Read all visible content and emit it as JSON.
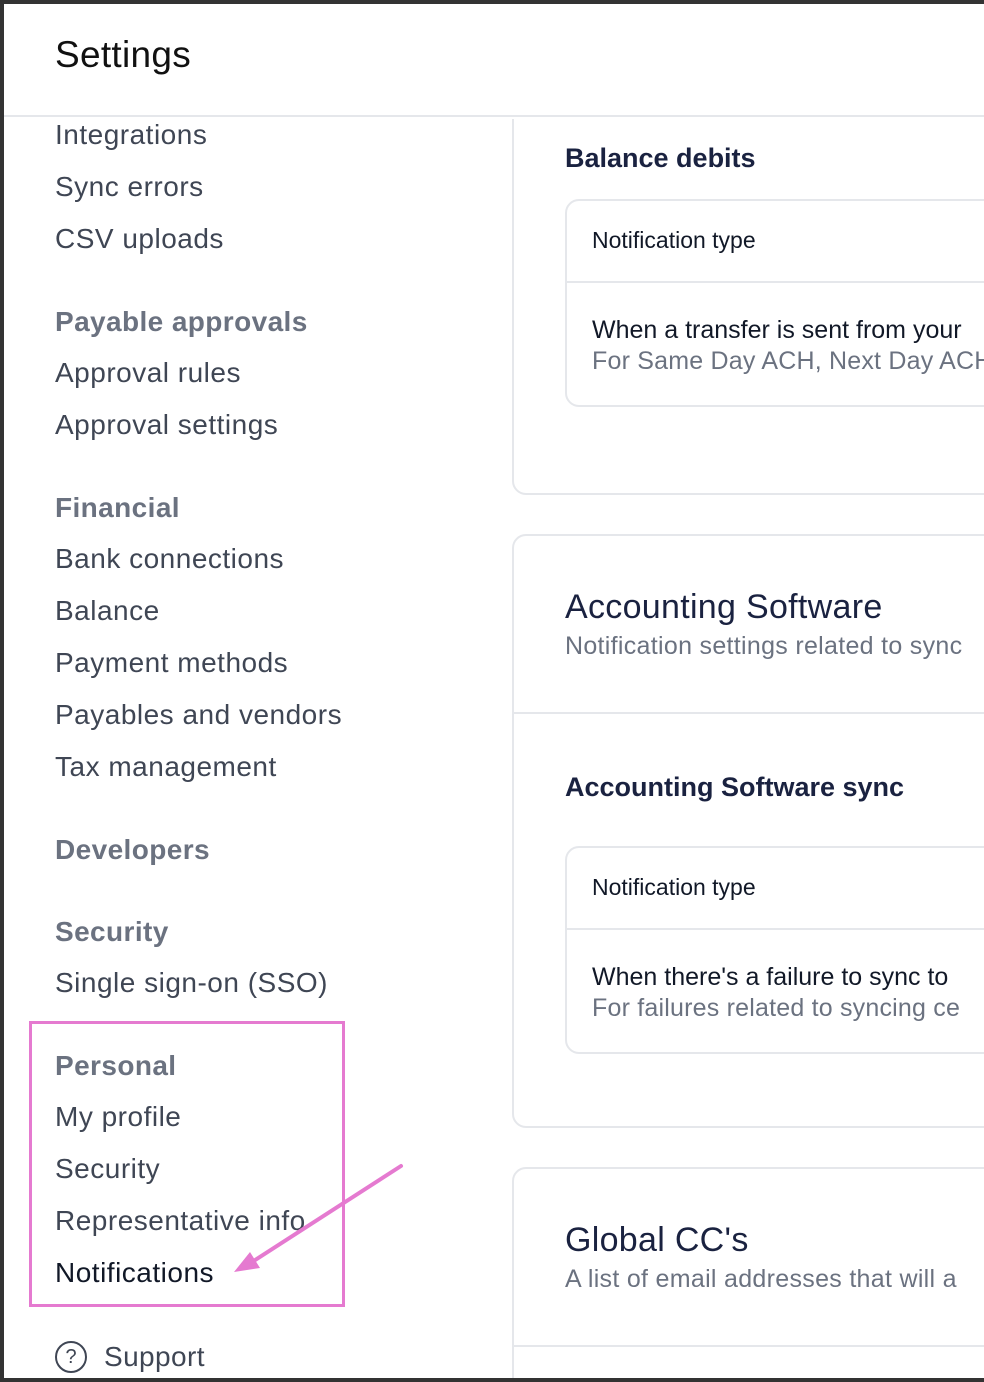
{
  "header": {
    "title": "Settings"
  },
  "sidebar": {
    "items": [
      {
        "label": "Integrations"
      },
      {
        "label": "Sync errors"
      },
      {
        "label": "CSV uploads"
      }
    ],
    "payable_approvals": {
      "heading": "Payable approvals",
      "items": [
        {
          "label": "Approval rules"
        },
        {
          "label": "Approval settings"
        }
      ]
    },
    "financial": {
      "heading": "Financial",
      "items": [
        {
          "label": "Bank connections"
        },
        {
          "label": "Balance"
        },
        {
          "label": "Payment methods"
        },
        {
          "label": "Payables and vendors"
        },
        {
          "label": "Tax management"
        }
      ]
    },
    "developers": {
      "heading": "Developers"
    },
    "security": {
      "heading": "Security",
      "items": [
        {
          "label": "Single sign-on (SSO)"
        }
      ]
    },
    "personal": {
      "heading": "Personal",
      "items": [
        {
          "label": "My profile"
        },
        {
          "label": "Security"
        },
        {
          "label": "Representative info"
        },
        {
          "label": "Notifications",
          "active": true
        }
      ]
    },
    "support": {
      "label": "Support",
      "icon": "question-circle-icon"
    }
  },
  "main": {
    "balance_debits": {
      "title": "Balance debits",
      "table_header": "Notification type",
      "row_main": "When a transfer is sent from your",
      "row_sub": "For Same Day ACH, Next Day ACH"
    },
    "accounting_software": {
      "title": "Accounting Software",
      "subtitle": "Notification settings related to sync",
      "sync": {
        "title": "Accounting Software sync",
        "table_header": "Notification type",
        "row_main": "When there's a failure to sync to",
        "row_sub": "For failures related to syncing ce"
      }
    },
    "global_cc": {
      "title": "Global CC's",
      "subtitle": "A list of email addresses that will a"
    }
  },
  "annotation": {
    "highlight_color": "#e57ad0"
  }
}
